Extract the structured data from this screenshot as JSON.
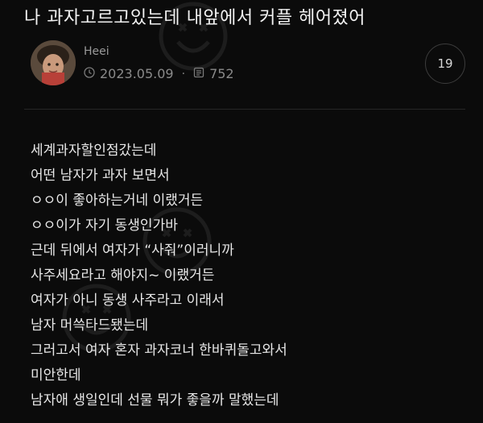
{
  "post": {
    "title": "나 과자고르고있는데 내앞에서 커플 헤어졌어",
    "author": "Heei",
    "date": "2023.05.09",
    "dot": "·",
    "views": "752",
    "comment_count": "19",
    "icons": [
      "avatar",
      "clock-icon",
      "views-icon",
      "smiley-watermark-icon"
    ],
    "body_lines": [
      "세계과자할인점갔는데",
      "어떤 남자가 과자 보면서",
      "ㅇㅇ이 좋아하는거네 이랬거든",
      "ㅇㅇ이가 자기 동생인가바",
      "근데 뒤에서 여자가 “사줘”이러니까",
      "사주세요라고 해야지~ 이랬거든",
      "여자가 아니 동생 사주라고 이래서",
      "남자 머쓱타드됐는데",
      "그러고서 여자 혼자 과자코너 한바퀴돌고와서",
      "미안한데",
      "남자애 생일인데 선물 뭐가 좋을까 말했는데"
    ]
  }
}
